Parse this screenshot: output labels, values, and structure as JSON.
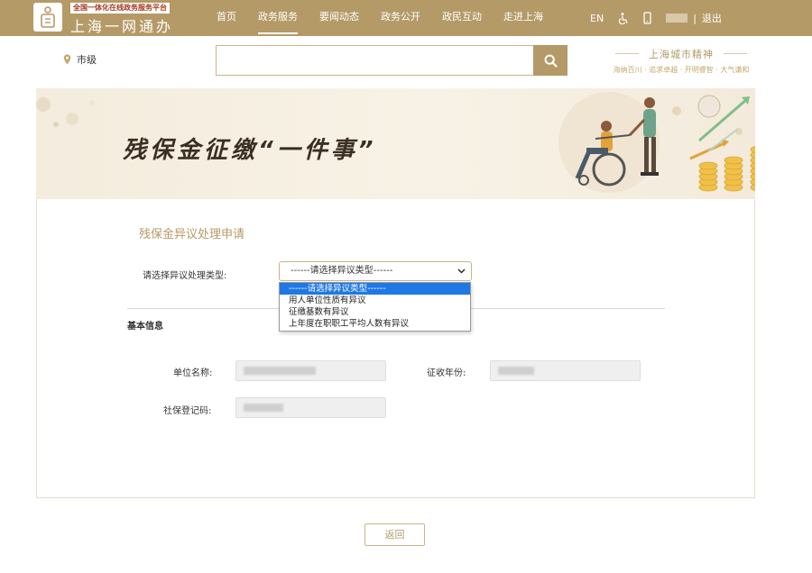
{
  "header": {
    "logo_sub": "全国一体化在线政务服务平台",
    "logo_title": "上海一网通办",
    "nav": [
      "首页",
      "政务服务",
      "要闻动态",
      "政务公开",
      "政民互动",
      "走进上海"
    ],
    "active_nav": "政务服务",
    "lang": "EN",
    "logout": "退出",
    "separator": "|"
  },
  "search": {
    "region": "市级",
    "placeholder": "",
    "value": ""
  },
  "spirit": {
    "title": "上海城市精神",
    "subtitle": "海纳百川 · 追求卓越 · 开明睿智 · 大气谦和"
  },
  "banner": {
    "title": "残保金征缴“一件事”"
  },
  "form": {
    "title": "残保金异议处理申请",
    "type_label": "请选择异议处理类型:",
    "type_selected": "------请选择异议类型------",
    "type_options": [
      "------请选择异议类型------",
      "用人单位性质有异议",
      "征缴基数有异议",
      "上年度在职职工平均人数有异议"
    ],
    "section_title": "基本信息",
    "fields": {
      "company_label": "单位名称:",
      "year_label": "征收年份:",
      "social_label": "社保登记码:"
    },
    "back": "返回"
  },
  "colors": {
    "brand": "#b49a67",
    "selected_option": "#1e78e6"
  }
}
